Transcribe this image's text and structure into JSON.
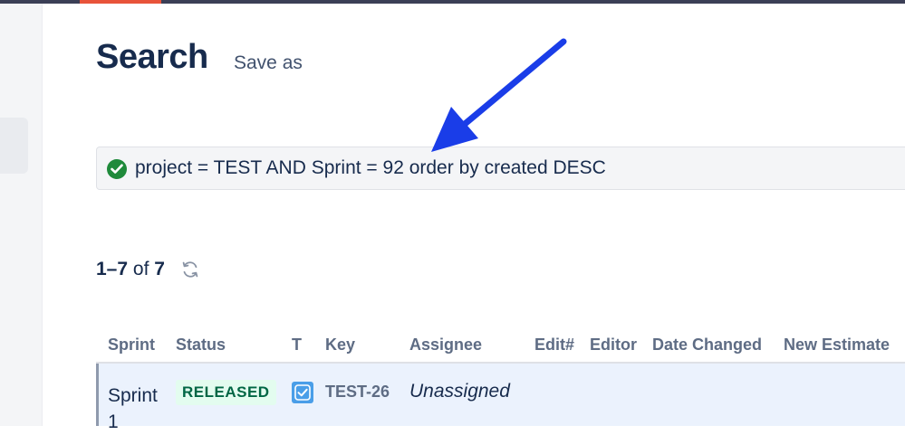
{
  "header": {
    "title": "Search",
    "save_as_label": "Save as"
  },
  "search": {
    "jql": "project = TEST AND Sprint = 92 order by created DESC",
    "status_icon": "check-circle-icon"
  },
  "results": {
    "range": "1–7",
    "of_label": "of",
    "total": "7",
    "refresh_icon": "refresh-icon"
  },
  "table": {
    "columns": [
      "Sprint",
      "Status",
      "T",
      "Key",
      "Assignee",
      "Edit#",
      "Editor",
      "Date Changed",
      "New Estimate"
    ],
    "rows": [
      {
        "sprint": "Sprint 1",
        "status": "RELEASED",
        "type_icon": "task-checkbox-icon",
        "key": "TEST-26",
        "assignee": "Unassigned"
      }
    ]
  },
  "colors": {
    "accent": "#e8533a",
    "arrow": "#1a3de8",
    "success": "#1f8a3b",
    "released_bg": "#e3fcef",
    "released_text": "#006644"
  }
}
